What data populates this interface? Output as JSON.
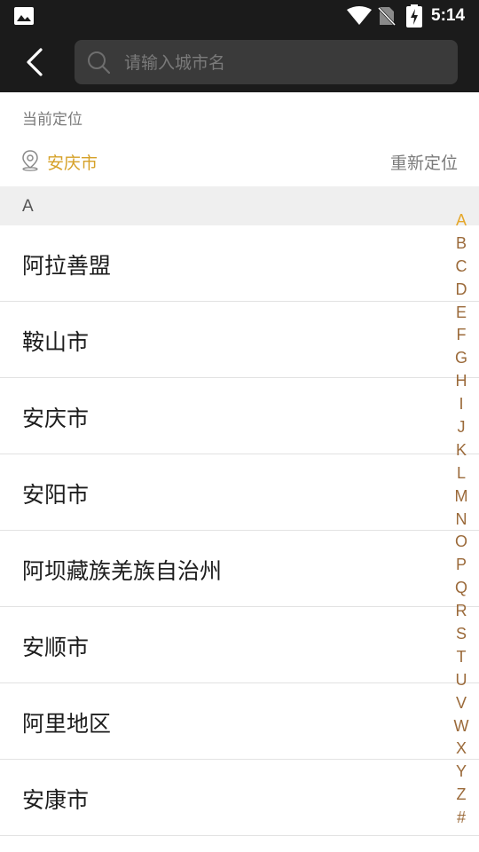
{
  "status_bar": {
    "time": "5:14"
  },
  "search": {
    "placeholder": "请输入城市名",
    "value": ""
  },
  "current_location": {
    "label": "当前定位",
    "city": "安庆市",
    "relocate_label": "重新定位"
  },
  "section": {
    "letter": "A"
  },
  "cities": [
    {
      "name": "阿拉善盟"
    },
    {
      "name": "鞍山市"
    },
    {
      "name": "安庆市"
    },
    {
      "name": "安阳市"
    },
    {
      "name": "阿坝藏族羌族自治州"
    },
    {
      "name": "安顺市"
    },
    {
      "name": "阿里地区"
    },
    {
      "name": "安康市"
    }
  ],
  "index_letters": [
    "A",
    "B",
    "C",
    "D",
    "E",
    "F",
    "G",
    "H",
    "I",
    "J",
    "K",
    "L",
    "M",
    "N",
    "O",
    "P",
    "Q",
    "R",
    "S",
    "T",
    "U",
    "V",
    "W",
    "X",
    "Y",
    "Z",
    "#"
  ],
  "active_letter": "A",
  "colors": {
    "accent": "#d6a128",
    "index_letter": "#9b6a3a",
    "app_bar": "#1b1b1b",
    "section_bg": "#efefef"
  },
  "icons": [
    "image-icon",
    "wifi-icon",
    "no-sim-icon",
    "battery-charging-icon",
    "back-arrow-icon",
    "search-icon",
    "location-pin-icon"
  ]
}
